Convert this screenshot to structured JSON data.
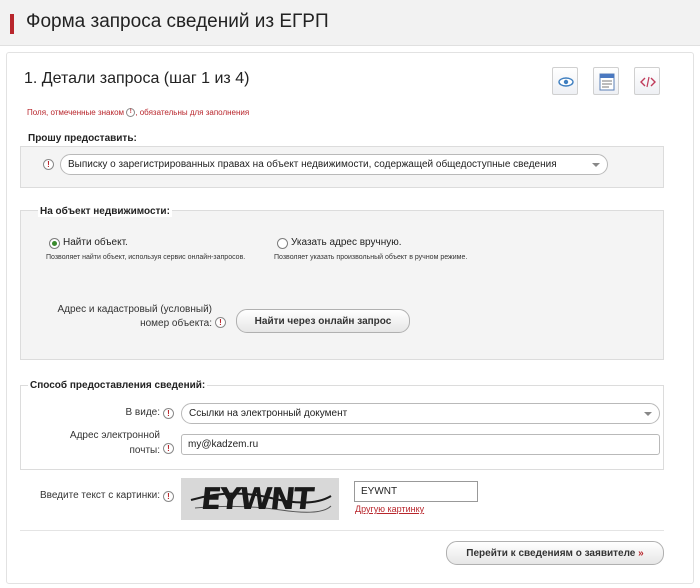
{
  "header": {
    "title": "Форма запроса сведений из ЕГРП"
  },
  "step": {
    "title": "1. Детали запроса (шаг 1 из 4)"
  },
  "toolbar": {
    "icons": [
      "eye-icon",
      "document-icon",
      "code-icon"
    ]
  },
  "required_note": {
    "before": "Поля, отмеченные знаком",
    "marker": "!",
    "after": ", обязательны для заполнения"
  },
  "provide": {
    "label": "Прошу предоставить:",
    "selected": "Выписку о зарегистрированных правах на объект недвижимости, содержащей общедоступные сведения"
  },
  "object": {
    "label": "На объект недвижимости:",
    "option_find": {
      "label": "Найти объект.",
      "desc": "Позволяет найти объект, используя сервис онлайн-запросов.",
      "checked": true
    },
    "option_manual": {
      "label": "Указать адрес вручную.",
      "desc": "Позволяет указать произвольный объект в ручном режиме.",
      "checked": false
    },
    "address_label_1": "Адрес и кадастровый (условный)",
    "address_label_2": "номер объекта:",
    "search_button": "Найти через онлайн запрос"
  },
  "delivery": {
    "label": "Способ предоставления сведений:",
    "form_label": "В виде:",
    "form_value": "Ссылки на электронный документ",
    "email_label_1": "Адрес электронной",
    "email_label_2": "почты:",
    "email_value": "my@kadzem.ru"
  },
  "captcha": {
    "label": "Введите текст с картинки:",
    "image_text": "EYWNT",
    "input_value": "EYWNT",
    "other_link": "Другую картинку"
  },
  "footer": {
    "next_button": "Перейти к сведениям о заявителе",
    "next_arrow": "»"
  },
  "colors": {
    "accent": "#b8262c",
    "radio_checked": "#3a8a2e"
  }
}
